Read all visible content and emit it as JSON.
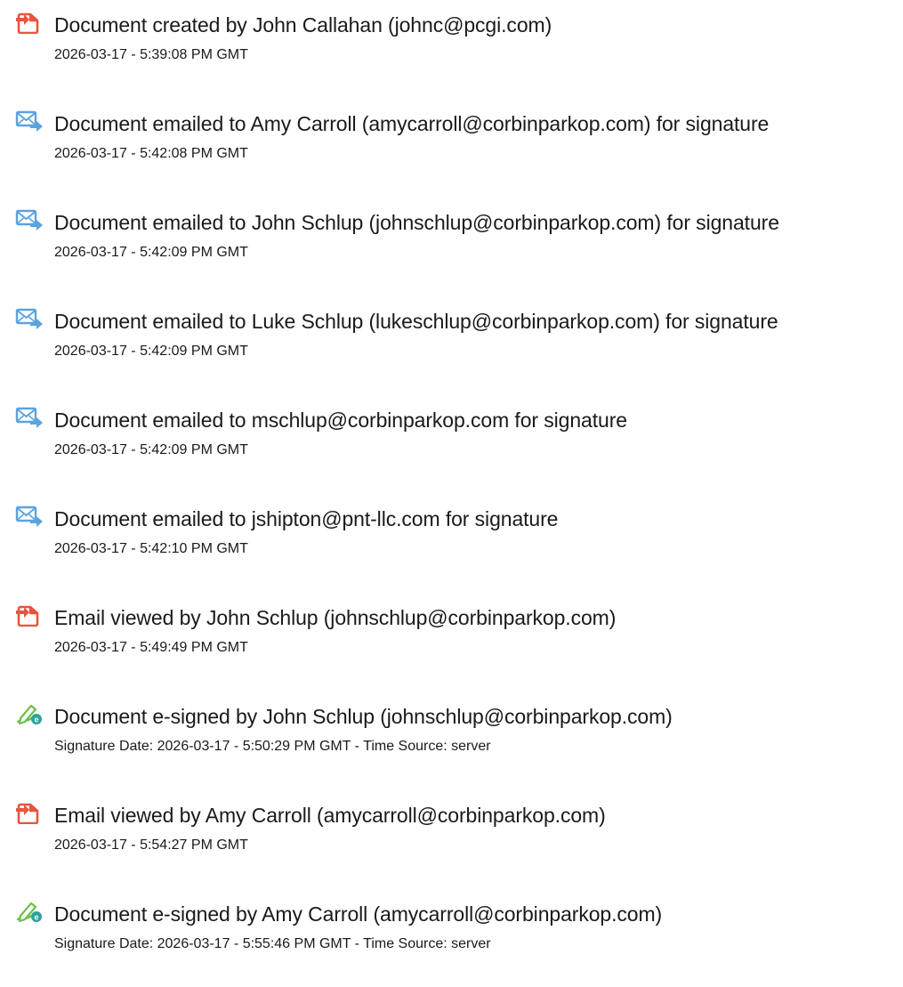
{
  "events": [
    {
      "icon": "document-created-icon",
      "title": "Document created by John Callahan (johnc@pcgi.com)",
      "date": "2026-03-17 - 5:39:08 PM GMT"
    },
    {
      "icon": "email-sent-icon",
      "title": "Document emailed to Amy Carroll (amycarroll@corbinparkop.com) for signature",
      "date": "2026-03-17 - 5:42:08 PM GMT"
    },
    {
      "icon": "email-sent-icon",
      "title": "Document emailed to John Schlup (johnschlup@corbinparkop.com) for signature",
      "date": "2026-03-17 - 5:42:09 PM GMT"
    },
    {
      "icon": "email-sent-icon",
      "title": "Document emailed to Luke Schlup (lukeschlup@corbinparkop.com) for signature",
      "date": "2026-03-17 - 5:42:09 PM GMT"
    },
    {
      "icon": "email-sent-icon",
      "title": "Document emailed to mschlup@corbinparkop.com for signature",
      "date": "2026-03-17 - 5:42:09 PM GMT"
    },
    {
      "icon": "email-sent-icon",
      "title": "Document emailed to jshipton@pnt-llc.com for signature",
      "date": "2026-03-17 - 5:42:10 PM GMT"
    },
    {
      "icon": "email-viewed-icon",
      "title": "Email viewed by John Schlup (johnschlup@corbinparkop.com)",
      "date": "2026-03-17 - 5:49:49 PM GMT"
    },
    {
      "icon": "e-signature-icon",
      "title": "Document e-signed by John Schlup (johnschlup@corbinparkop.com)",
      "date": "Signature Date: 2026-03-17 - 5:50:29 PM GMT - Time Source: server"
    },
    {
      "icon": "email-viewed-icon",
      "title": "Email viewed by Amy Carroll (amycarroll@corbinparkop.com)",
      "date": "2026-03-17 - 5:54:27 PM GMT"
    },
    {
      "icon": "e-signature-icon",
      "title": "Document e-signed by Amy Carroll (amycarroll@corbinparkop.com)",
      "date": "Signature Date: 2026-03-17 - 5:55:46 PM GMT - Time Source: server"
    }
  ],
  "colors": {
    "document_icon": "#e8553e",
    "email_icon": "#5ca3de",
    "signature_icon": "#2aa39a",
    "text": "#1a1a1a"
  }
}
